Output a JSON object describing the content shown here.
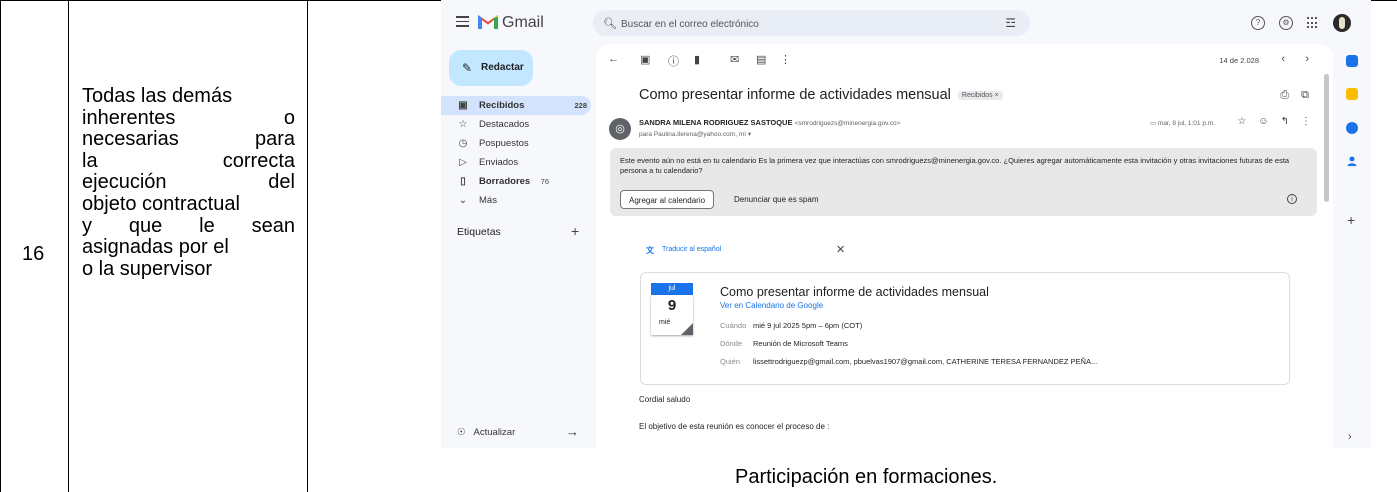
{
  "document": {
    "row_number": "16",
    "duty_lines": [
      "Todas las demás",
      "inherentes o",
      "necesarias para",
      "la correcta",
      "ejecución del",
      "objeto contractual",
      "y que le sean",
      "asignadas por el",
      "o la supervisor"
    ],
    "caption": "Participación en formaciones."
  },
  "gmail": {
    "logo_text": "Gmail",
    "search": {
      "placeholder": "Buscar en el correo electrónico"
    },
    "compose_label": "Redactar",
    "nav": [
      {
        "label": "Recibidos",
        "count": "228",
        "icon": "inbox-icon"
      },
      {
        "label": "Destacados",
        "count": "",
        "icon": "star-icon"
      },
      {
        "label": "Pospuestos",
        "count": "",
        "icon": "clock-icon"
      },
      {
        "label": "Enviados",
        "count": "",
        "icon": "send-icon"
      },
      {
        "label": "Borradores",
        "count": "76",
        "icon": "draft-icon"
      },
      {
        "label": "Más",
        "count": "",
        "icon": "chevron-down-icon"
      }
    ],
    "labels_heading": "Etiquetas",
    "refresh_label": "Actualizar",
    "pager": "14 de 2.028",
    "message": {
      "subject": "Como presentar informe de actividades mensual",
      "subject_label": "Recibidos ×",
      "sender_name": "SANDRA MILENA RODRIGUEZ SASTOQUE",
      "sender_email": "<smrodriguezs@minenergia.gov.co>",
      "recipient": "para Paulina.llerena@yahoo.com, mí ▾",
      "date": "mar, 8 jul, 1:01 p.m.",
      "calendar_banner_text": "Este evento aún no está en tu calendario Es la primera vez que interactúas con smrodriguezs@minenergia.gov.co. ¿Quieres agregar automáticamente esta invitación y otras invitaciones futuras de esta persona a tu calendario?",
      "add_calendar_button": "Agregar al calendario",
      "report_spam_button": "Denunciar que es spam",
      "translate_link": "Traducir al español",
      "event": {
        "month": "jul",
        "day": "9",
        "weekday": "mié",
        "title": "Como presentar informe de actividades mensual",
        "calendar_link": "Ver en Calendario de Google",
        "when_label": "Cuándo",
        "when_value": "mié 9 jul 2025 5pm – 6pm (COT)",
        "where_label": "Dónde",
        "where_value": "Reunión de Microsoft Teams",
        "who_label": "Quién",
        "who_value": "lissettrodriguezp@gmail.com, pbuelvas1907@gmail.com, CATHERINE TERESA FERNANDEZ PEÑA..."
      },
      "greeting": "Cordial saludo",
      "body_line": "El objetivo de esta reunión es conocer el proceso de :"
    },
    "colors": {
      "accent_blue": "#1a73e8",
      "compose_bg": "#c2e7ff",
      "active_nav_bg": "#d3e3fd",
      "rail_calendar": "#1a73e8",
      "rail_keep": "#fbbc04",
      "rail_tasks": "#1a73e8",
      "rail_contacts": "#1a73e8"
    }
  }
}
